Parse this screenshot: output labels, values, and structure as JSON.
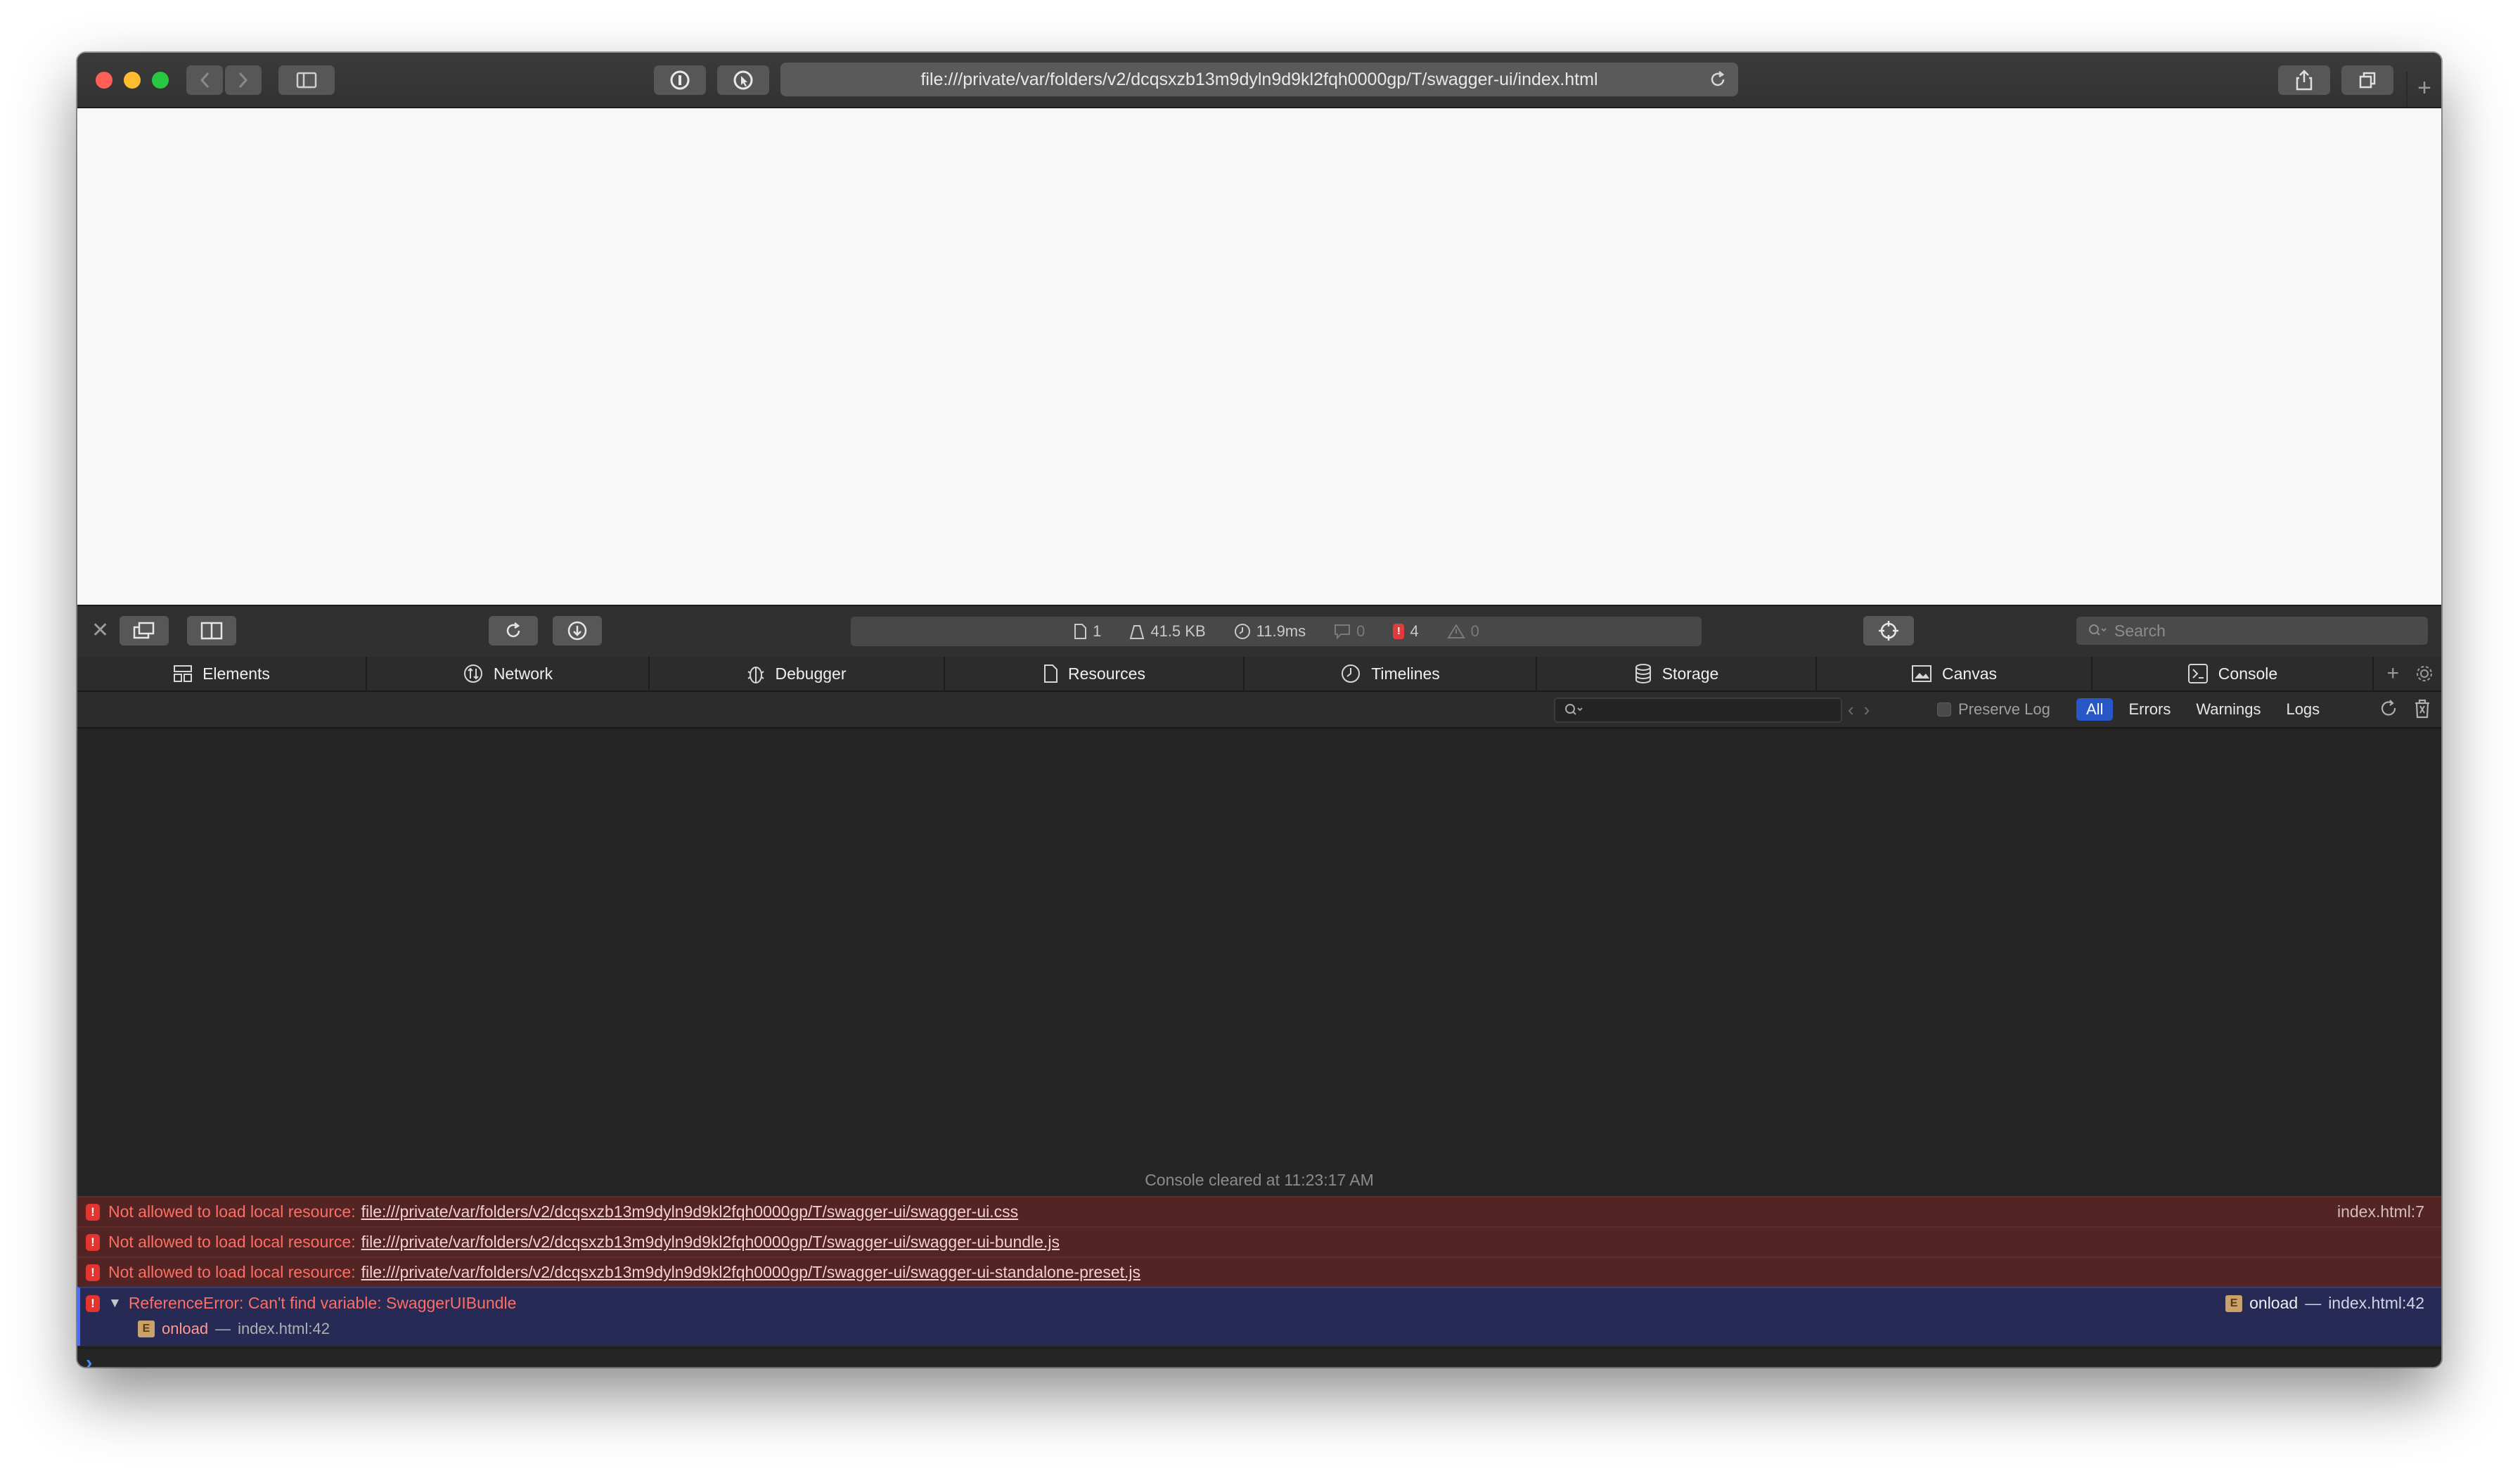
{
  "browser": {
    "url": "file:///private/var/folders/v2/dcqsxzb13m9dyln9d9kl2fqh0000gp/T/swagger-ui/index.html"
  },
  "devtools": {
    "activity": {
      "resources": "1",
      "size": "41.5 KB",
      "time": "11.9ms",
      "logs": "0",
      "errors": "4",
      "warnings": "0"
    },
    "search_placeholder": "Search",
    "tabs": [
      {
        "label": "Elements",
        "icon": "elements-icon"
      },
      {
        "label": "Network",
        "icon": "network-icon"
      },
      {
        "label": "Debugger",
        "icon": "debugger-icon"
      },
      {
        "label": "Resources",
        "icon": "resources-icon"
      },
      {
        "label": "Timelines",
        "icon": "timelines-icon"
      },
      {
        "label": "Storage",
        "icon": "storage-icon"
      },
      {
        "label": "Canvas",
        "icon": "canvas-icon"
      },
      {
        "label": "Console",
        "icon": "console-icon"
      }
    ],
    "filter": {
      "preserve_log": "Preserve Log",
      "levels": [
        "All",
        "Errors",
        "Warnings",
        "Logs"
      ],
      "active_level": "All"
    }
  },
  "console": {
    "cleared_text": "Console cleared at 11:23:17 AM",
    "messages": [
      {
        "text": "Not allowed to load local resource:",
        "link": "file:///private/var/folders/v2/dcqsxzb13m9dyln9d9kl2fqh0000gp/T/swagger-ui/swagger-ui.css",
        "location": "index.html:7"
      },
      {
        "text": "Not allowed to load local resource:",
        "link": "file:///private/var/folders/v2/dcqsxzb13m9dyln9d9kl2fqh0000gp/T/swagger-ui/swagger-ui-bundle.js"
      },
      {
        "text": "Not allowed to load local resource:",
        "link": "file:///private/var/folders/v2/dcqsxzb13m9dyln9d9kl2fqh0000gp/T/swagger-ui/swagger-ui-standalone-preset.js"
      }
    ],
    "expanded_error": {
      "text": "ReferenceError: Can't find variable: SwaggerUIBundle",
      "right_function": "onload",
      "right_location": "index.html:42",
      "frame_function": "onload",
      "frame_location": "index.html:42",
      "frame_badge": "E"
    },
    "colors": {
      "error_row": "#522424",
      "selected_row": "#262a55",
      "error_text": "#ff6e64",
      "accent": "#2857c7"
    }
  }
}
